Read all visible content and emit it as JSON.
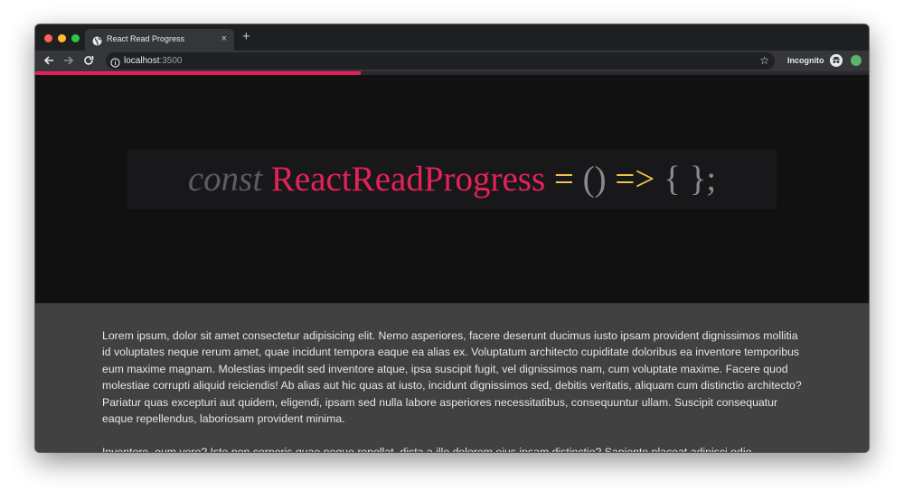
{
  "browser": {
    "tab": {
      "title": "React Read Progress",
      "close": "×"
    },
    "new_tab": "+",
    "address": {
      "host": "localhost",
      "port": ":3500"
    },
    "star": "☆",
    "profile": "Incognito"
  },
  "read_progress": {
    "fraction": 0.39,
    "color": "#e6215a"
  },
  "hero": {
    "code": {
      "keyword": "const",
      "name": "ReactReadProgress",
      "equals": "=",
      "parens": "()",
      "arrow": "=>",
      "braces": "{ };"
    }
  },
  "article": {
    "paragraphs": [
      "Lorem ipsum, dolor sit amet consectetur adipisicing elit. Nemo asperiores, facere deserunt ducimus iusto ipsam provident dignissimos mollitia id voluptates neque rerum amet, quae incidunt tempora eaque ea alias ex. Voluptatum architecto cupiditate doloribus ea inventore temporibus eum maxime magnam. Molestias impedit sed inventore atque, ipsa suscipit fugit, vel dignissimos nam, cum voluptate maxime. Facere quod molestiae corrupti aliquid reiciendis! Ab alias aut hic quas at iusto, incidunt dignissimos sed, debitis veritatis, aliquam cum distinctio architecto? Pariatur quas excepturi aut quidem, eligendi, ipsam sed nulla labore asperiores necessitatibus, consequuntur ullam. Suscipit consequatur eaque repellendus, laboriosam provident minima.",
      "Inventore, eum vero? Iste non corporis quae neque repellat, dicta a illo dolorem eius ipsam distinctio? Sapiente placeat adipisci odio"
    ]
  },
  "colors": {
    "accent": "#e6215a",
    "operator": "#f1c24c",
    "hero_bg": "#111112",
    "article_bg": "#414141"
  }
}
